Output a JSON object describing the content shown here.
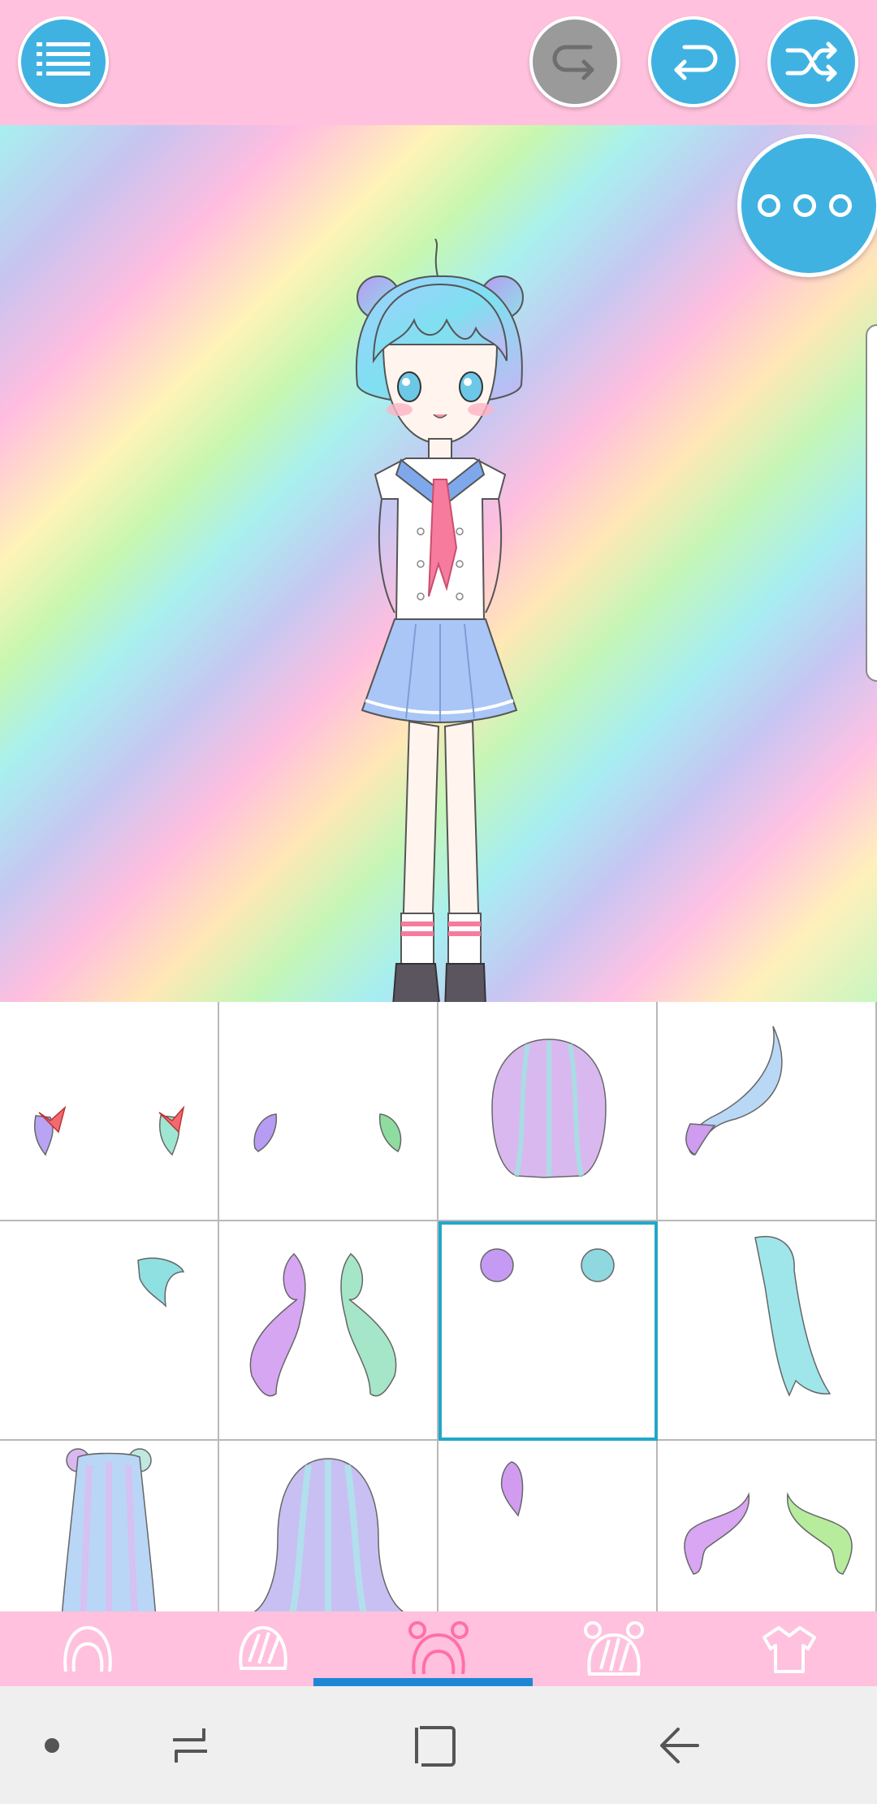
{
  "topbar": {
    "menu_icon": "list-menu-icon",
    "redo_icon": "redo-arrow-icon",
    "redo_enabled": false,
    "undo_icon": "undo-arrow-icon",
    "shuffle_icon": "shuffle-icon",
    "colors": {
      "background": "#ffc1dd",
      "button": "#3fb2e2",
      "button_disabled": "#9a9a9a"
    }
  },
  "canvas": {
    "background": "pastel-rainbow-diagonal",
    "character": "chibi-girl-sailor-uniform-pastel-hair",
    "more_button_icon": "three-dots-icon"
  },
  "grid": {
    "selected_index": 6,
    "items": [
      {
        "name": "item-ribbon-side-tufts",
        "icon": "side-tufts-red-ribbons"
      },
      {
        "name": "item-braided-tufts",
        "icon": "braided-side-tufts"
      },
      {
        "name": "item-short-bob",
        "icon": "short-bob-hair"
      },
      {
        "name": "item-long-ponytail",
        "icon": "long-swoop-ponytail"
      },
      {
        "name": "item-small-side-curl",
        "icon": "small-side-curl"
      },
      {
        "name": "item-twin-tails",
        "icon": "low-twin-tails"
      },
      {
        "name": "item-double-buns",
        "icon": "double-buns"
      },
      {
        "name": "item-long-straight-side",
        "icon": "long-straight-side-hair"
      },
      {
        "name": "item-long-twin-buns",
        "icon": "long-hair-with-buns"
      },
      {
        "name": "item-long-back-hair",
        "icon": "long-straight-back-hair"
      },
      {
        "name": "item-small-ponytail",
        "icon": "small-ponytail"
      },
      {
        "name": "item-curly-twin-tails",
        "icon": "curly-twin-tails"
      }
    ]
  },
  "tabs": {
    "active_index": 2,
    "items": [
      {
        "name": "tab-face",
        "icon": "face-outline-icon"
      },
      {
        "name": "tab-front-hair",
        "icon": "front-hair-icon"
      },
      {
        "name": "tab-hair-accessory",
        "icon": "bun-hair-icon"
      },
      {
        "name": "tab-back-hair",
        "icon": "back-hair-icon"
      },
      {
        "name": "tab-clothes",
        "icon": "shirt-icon"
      }
    ],
    "colors": {
      "background": "#ffc1dd",
      "icon": "#ffffff",
      "icon_active": "#ff6fa8",
      "indicator": "#1f86d6"
    }
  },
  "system_nav": {
    "recents_icon": "recent-apps-icon",
    "home_icon": "home-square-icon",
    "back_icon": "back-arrow-icon",
    "dot_icon": "dot-icon"
  }
}
